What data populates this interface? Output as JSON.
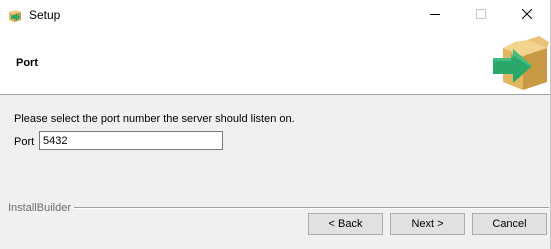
{
  "window": {
    "title": "Setup",
    "app_icon": "package-arrow-icon",
    "controls": {
      "minimize_icon": "minimize-icon",
      "maximize_icon": "maximize-icon",
      "close_icon": "close-icon"
    }
  },
  "header": {
    "title": "Port",
    "logo_icon": "box-arrow-logo-icon"
  },
  "body": {
    "instruction": "Please select the port number the server should listen on.",
    "port": {
      "label": "Port",
      "value": "5432"
    }
  },
  "footer": {
    "brand": "InstallBuilder",
    "buttons": {
      "back": "< Back",
      "next": "Next >",
      "cancel": "Cancel"
    }
  },
  "colors": {
    "box_tan": "#e3b760",
    "box_dark": "#c99a45",
    "arrow_green": "#2aa86a",
    "window_bg": "#f0f0f0",
    "header_bg": "#ffffff"
  }
}
